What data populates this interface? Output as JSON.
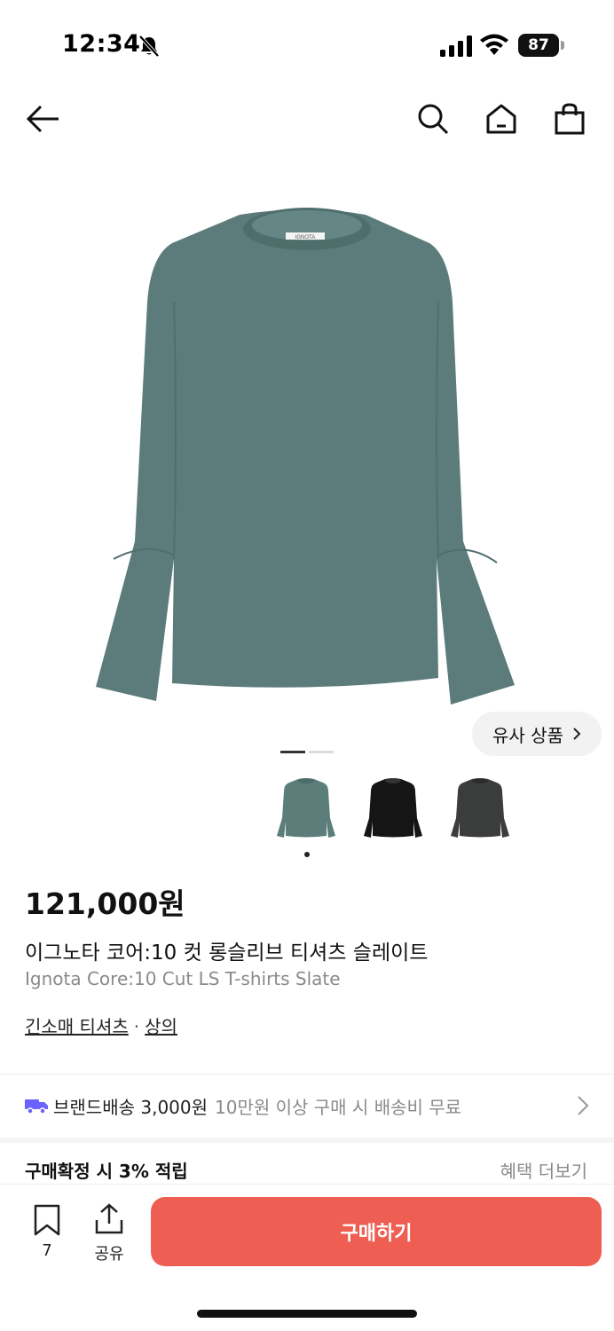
{
  "status_bar": {
    "time": "12:34",
    "battery": "87"
  },
  "nav": {
    "back_icon": "arrow-left-icon",
    "search_icon": "search-icon",
    "home_icon": "home-icon",
    "cart_icon": "shopping-bag-icon"
  },
  "gallery": {
    "similar_label": "유사 상품",
    "page_count": 2,
    "active_page": 1,
    "thumbnails": [
      {
        "color": "#5c7e7b",
        "name": "slate"
      },
      {
        "color": "#151515",
        "name": "black"
      },
      {
        "color": "#3b3d3d",
        "name": "charcoal"
      }
    ],
    "selected_thumbnail": 1,
    "main_color": "#5b7c7a"
  },
  "product": {
    "price": "121,000원",
    "name_ko": "이그노타 코어:10 컷 롱슬리브 티셔츠 슬레이트",
    "name_en": "Ignota Core:10 Cut LS T-shirts Slate",
    "category_1": "긴소매 티셔츠",
    "category_sep": "·",
    "category_2": "상의",
    "label_brand": "IGNOTA"
  },
  "shipping": {
    "label": "브랜드배송 3,000원",
    "sub": "10만원 이상 구매 시 배송비 무료"
  },
  "points": {
    "label": "구매확정 시 3% 적립",
    "more": "혜택 더보기"
  },
  "bottom": {
    "bookmark_count": "7",
    "share_label": "공유",
    "buy_label": "구매하기"
  },
  "colors": {
    "accent": "#ee5e52",
    "truck": "#6c63ff"
  }
}
